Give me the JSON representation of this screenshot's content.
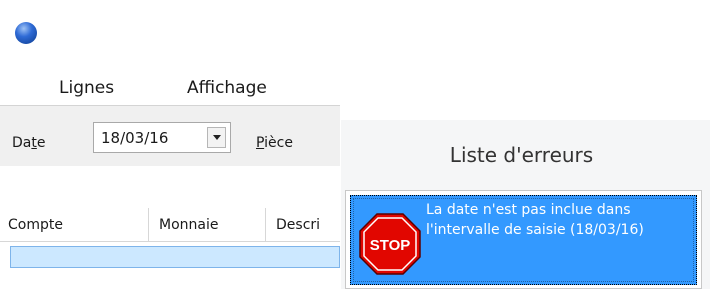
{
  "menu": {
    "lignes": "Lignes",
    "affichage": "Affichage"
  },
  "toolbar": {
    "date_label_prefix": "Da",
    "date_label_underlined": "t",
    "date_label_suffix": "e",
    "date_value": "18/03/16",
    "piece_label_underlined": "P",
    "piece_label_suffix": "ièce"
  },
  "grid": {
    "columns": [
      "Compte",
      "Monnaie",
      "Descri"
    ]
  },
  "error_list": {
    "title": "Liste d'erreurs",
    "items": [
      {
        "icon": "stop-icon",
        "icon_text": "STOP",
        "message": "La date n'est pas inclue dans l'intervalle de saisie (18/03/16)"
      }
    ]
  },
  "colors": {
    "selection": "#3399ff",
    "row_highlight": "#cce8ff",
    "stop_red": "#e10600"
  }
}
